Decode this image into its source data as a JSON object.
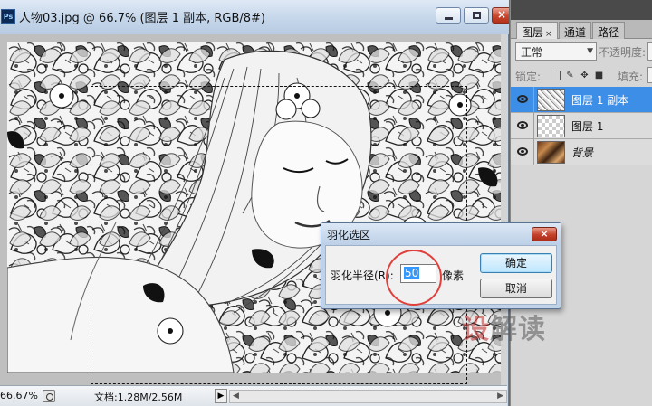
{
  "document": {
    "title": "人物03.jpg @ 66.7% (图层 1 副本, RGB/8#)",
    "app_badge": "Ps",
    "zoom": "66.67%",
    "doc_size": "文档:1.28M/2.56M"
  },
  "layers_panel": {
    "tabs": [
      {
        "label": "图层",
        "close": "×",
        "active": true
      },
      {
        "label": "通道",
        "active": false
      },
      {
        "label": "路径",
        "active": false
      }
    ],
    "blend_mode": "正常",
    "opacity_label": "不透明度:",
    "lock_label": "锁定:",
    "fill_label": "填充:",
    "layers": [
      {
        "name": "图层 1 副本",
        "selected": true,
        "thumb": "sketch"
      },
      {
        "name": "图层 1",
        "selected": false,
        "thumb": "transparent"
      },
      {
        "name": "背景",
        "selected": false,
        "thumb": "photo"
      }
    ]
  },
  "feather_dialog": {
    "title": "羽化选区",
    "close": "×",
    "radius_label": "羽化半径(R):",
    "radius_value": "50",
    "unit": "像素",
    "ok": "确定",
    "cancel": "取消"
  },
  "watermark": {
    "part1": "设",
    "part2": "解读"
  },
  "colors": {
    "selected_layer": "#3d8ee6",
    "annotation_circle": "#e0403c",
    "watermark": "#be2828"
  }
}
